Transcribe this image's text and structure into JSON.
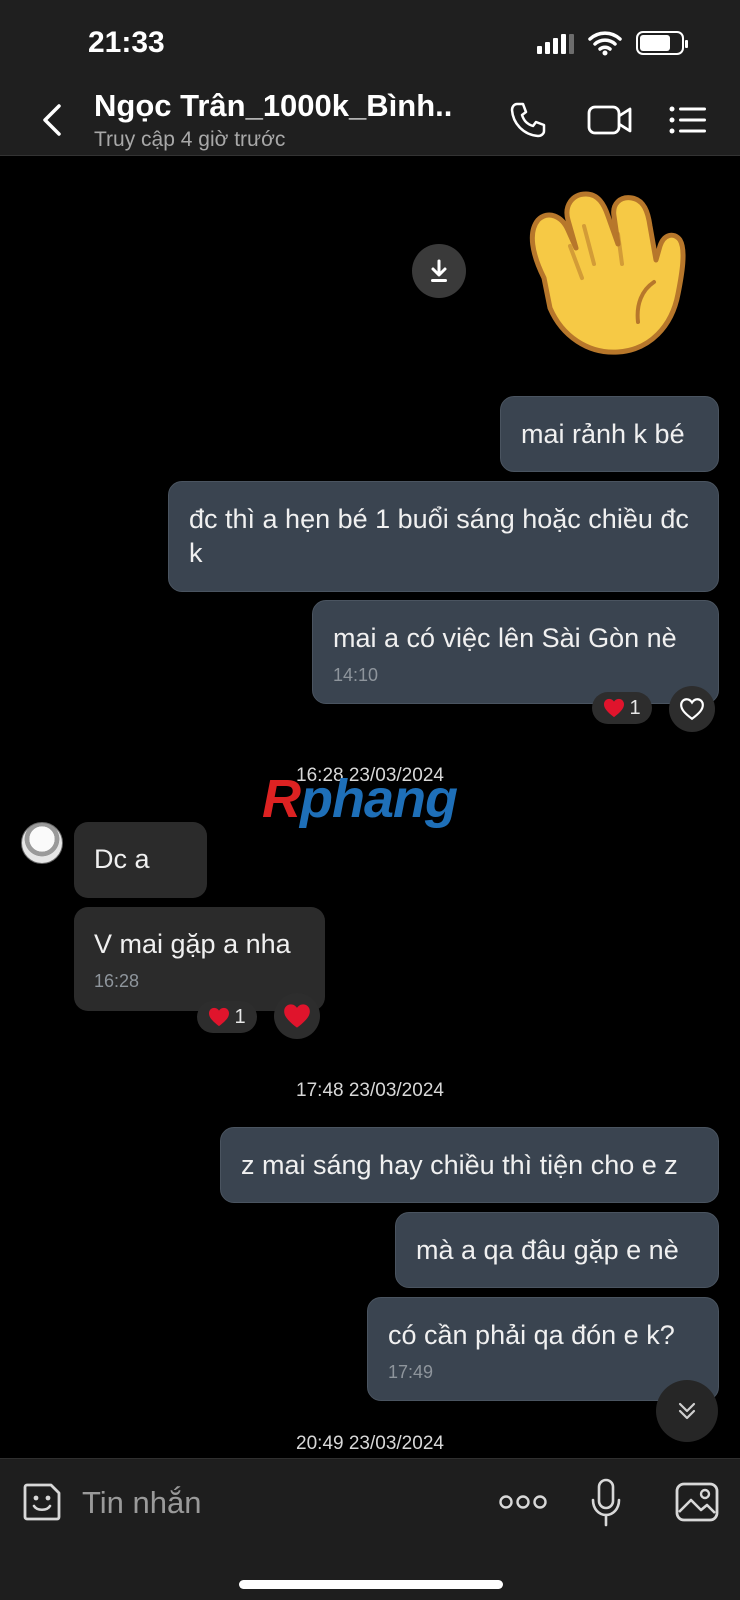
{
  "status_bar": {
    "time": "21:33"
  },
  "header": {
    "contact_name": "Ngọc Trân_1000k_Bình...",
    "contact_status": "Truy cập 4 giờ trước"
  },
  "messages": [
    {
      "text": "mai rảnh k bé"
    },
    {
      "text": "đc thì a hẹn bé 1 buổi sáng hoặc chiều đc k"
    },
    {
      "text": "mai a có việc lên Sài Gòn nè",
      "time": "14:10",
      "reaction_count": "1"
    },
    {
      "text": "Dc a"
    },
    {
      "text": "V mai gặp a nha",
      "time": "16:28",
      "reaction_count": "1"
    },
    {
      "text": "z mai sáng hay chiều thì tiện cho e z"
    },
    {
      "text": "mà a qa đâu gặp e nè"
    },
    {
      "text": "có cần phải qa đón e k?",
      "time": "17:49"
    }
  ],
  "date_separators": [
    "16:28 23/03/2024",
    "17:48 23/03/2024",
    "20:49 23/03/2024"
  ],
  "watermark": {
    "first": "R",
    "rest": "phang"
  },
  "input": {
    "placeholder": "Tin nhắn"
  },
  "colors": {
    "outgoing_bubble": "#3a4450",
    "incoming_bubble": "#2b2b2b",
    "background": "#000000",
    "heart": "#e0142c"
  }
}
